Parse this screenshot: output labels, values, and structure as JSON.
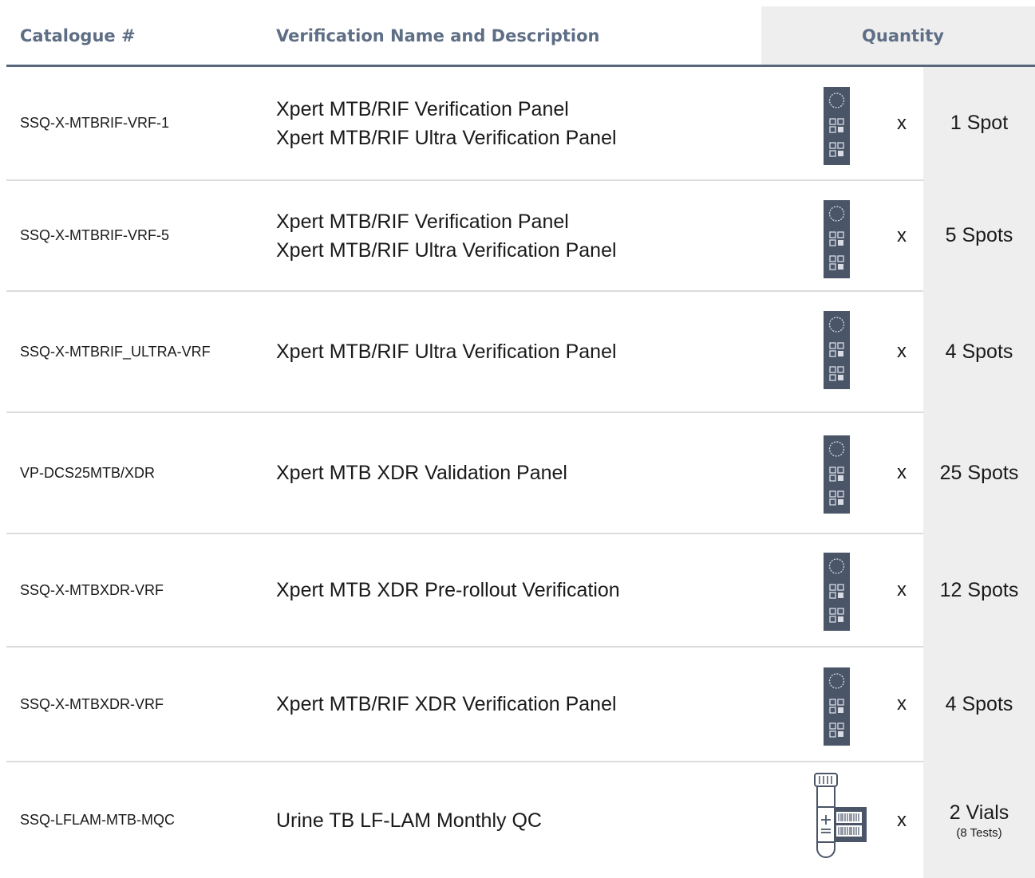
{
  "header": {
    "catalogue": "Catalogue #",
    "description": "Verification Name and Description",
    "quantity": "Quantity"
  },
  "multiplier": "x",
  "rows": [
    {
      "catalogue": "SSQ-X-MTBRIF-VRF-1",
      "lines": [
        "Xpert MTB/RIF Verification Panel",
        "Xpert MTB/RIF Ultra Verification Panel"
      ],
      "icon": "spot-card-icon",
      "quantity": "1 Spot",
      "quantity_note": ""
    },
    {
      "catalogue": "SSQ-X-MTBRIF-VRF-5",
      "lines": [
        "Xpert MTB/RIF Verification Panel",
        "Xpert MTB/RIF Ultra Verification Panel"
      ],
      "icon": "spot-card-icon",
      "quantity": "5 Spots",
      "quantity_note": ""
    },
    {
      "catalogue": "SSQ-X-MTBRIF_ULTRA-VRF",
      "lines": [
        "Xpert MTB/RIF Ultra Verification Panel",
        ""
      ],
      "icon": "spot-card-icon",
      "quantity": "4 Spots",
      "quantity_note": ""
    },
    {
      "catalogue": "VP-DCS25MTB/XDR",
      "lines": [
        "Xpert MTB XDR Validation Panel",
        ""
      ],
      "icon": "spot-card-icon",
      "quantity": "25 Spots",
      "quantity_note": ""
    },
    {
      "catalogue": "SSQ-X-MTBXDR-VRF",
      "lines": [
        "Xpert MTB XDR Pre-rollout Verification",
        ""
      ],
      "icon": "spot-card-icon",
      "quantity": "12 Spots",
      "quantity_note": ""
    },
    {
      "catalogue": "SSQ-X-MTBXDR-VRF",
      "lines": [
        "Xpert MTB/RIF XDR Verification Panel",
        ""
      ],
      "icon": "spot-card-icon",
      "quantity": "4 Spots",
      "quantity_note": ""
    },
    {
      "catalogue": "SSQ-LFLAM-MTB-MQC",
      "lines": [
        "Urine TB LF-LAM Monthly QC",
        ""
      ],
      "icon": "vial-barcode-icon",
      "quantity": "2 Vials",
      "quantity_note": "(8 Tests)"
    }
  ],
  "colors": {
    "header_text": "#5e6e85",
    "header_rule": "#57667a",
    "quantity_bg": "#eeeeee",
    "icon_fill": "#4a5567"
  }
}
